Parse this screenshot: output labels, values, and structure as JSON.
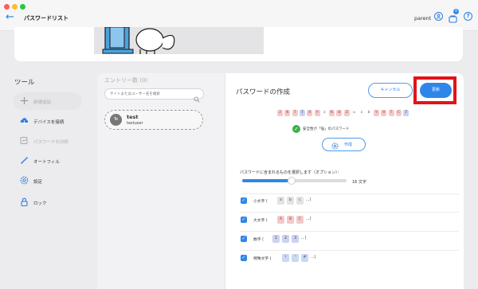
{
  "window": {
    "title": "パスワードリスト",
    "back_icon": "arrow-left-icon",
    "user": "parent",
    "badge_count": "0"
  },
  "colors": {
    "accent": "#2f86e9",
    "highlight": "#e4121a",
    "success": "#3fae49"
  },
  "sidebar": {
    "title": "ツール",
    "items": [
      {
        "label": "新規追加",
        "icon": "plus-icon",
        "state": "active"
      },
      {
        "label": "デバイスを接続",
        "icon": "cloud-icon",
        "state": "normal"
      },
      {
        "label": "パスワードの分析",
        "icon": "analysis-icon",
        "state": "disabled"
      },
      {
        "label": "オートフィル",
        "icon": "magic-wand-icon",
        "state": "normal"
      },
      {
        "label": "設定",
        "icon": "gear-icon",
        "state": "normal"
      },
      {
        "label": "ロック",
        "icon": "lock-icon",
        "state": "normal"
      }
    ]
  },
  "entries": {
    "title": "エントリー数 (0)",
    "search_placeholder": "サイトまたはユーザー名を検索",
    "items": [
      {
        "avatar": "Te",
        "name": "test",
        "user": "testuser"
      }
    ]
  },
  "generator": {
    "title": "パスワードの作成",
    "cancel_label": "キャンセル",
    "update_label": "更新",
    "password_chars": [
      {
        "c": "J",
        "t": "u"
      },
      {
        "c": "K",
        "t": "u"
      },
      {
        "c": "T",
        "t": "u"
      },
      {
        "c": "7",
        "t": "d"
      },
      {
        "c": "X",
        "t": "u"
      },
      {
        "c": "Y",
        "t": "u"
      },
      {
        "c": "z",
        "t": "l"
      },
      {
        "c": "K",
        "t": "u"
      },
      {
        "c": "U",
        "t": "u"
      },
      {
        "c": "Z",
        "t": "u"
      },
      {
        "c": "u",
        "t": "l"
      },
      {
        "c": "z",
        "t": "l"
      },
      {
        "c": "b",
        "t": "l"
      },
      {
        "c": "Y",
        "t": "u"
      },
      {
        "c": "H",
        "t": "u"
      },
      {
        "c": "T",
        "t": "u"
      },
      {
        "c": "C",
        "t": "u"
      },
      {
        "c": "7",
        "t": "d"
      }
    ],
    "strength_text": "安全性が「強」のパスワード",
    "generate_label": "作成",
    "include_label": "パスワードに含まれるものを選択します（オプション）：",
    "length_label": "16 文字",
    "length_value": 16,
    "length_fraction": 0.47,
    "options": [
      {
        "label": "小文字 (",
        "chips": [
          "a",
          "b",
          "c"
        ],
        "kind": "l",
        "tail": "...)",
        "checked": true
      },
      {
        "label": "大文字 (",
        "chips": [
          "A",
          "B",
          "C"
        ],
        "kind": "u",
        "tail": "...)",
        "checked": true
      },
      {
        "label": "数字 (",
        "chips": [
          "1",
          "2",
          "3"
        ],
        "kind": "d",
        "tail": "...)",
        "checked": true
      },
      {
        "label": "特殊文字 (",
        "chips": [
          "!",
          "'",
          "#"
        ],
        "kind": "s",
        "tail": "...)",
        "checked": true
      }
    ]
  }
}
